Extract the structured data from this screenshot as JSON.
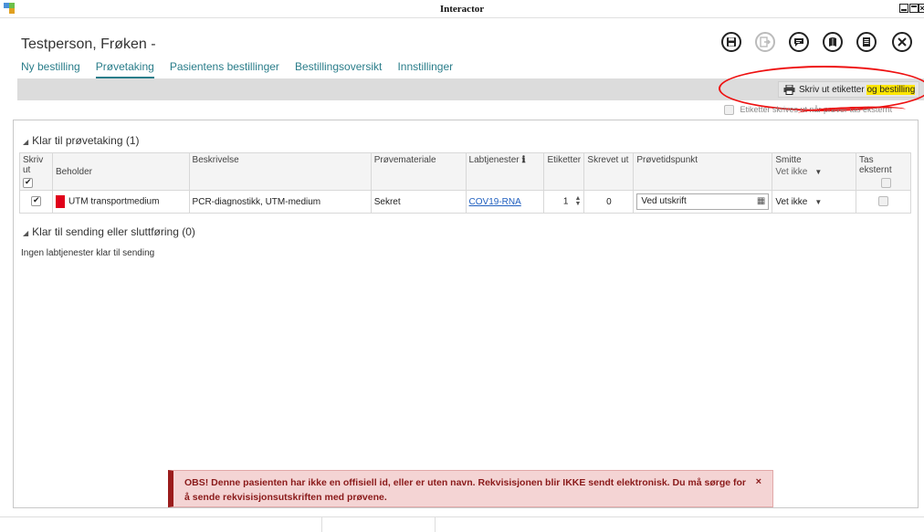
{
  "window": {
    "title": "Interactor"
  },
  "patient": {
    "name": "Testperson, Frøken -"
  },
  "nav": {
    "tabs": [
      {
        "label": "Ny bestilling"
      },
      {
        "label": "Prøvetaking"
      },
      {
        "label": "Pasientens bestillinger"
      },
      {
        "label": "Bestillingsoversikt"
      },
      {
        "label": "Innstillinger"
      }
    ],
    "active_tab": "Prøvetaking"
  },
  "toolbar": {
    "icons": [
      "save-icon",
      "export-icon",
      "comment-icon",
      "book-icon",
      "document-icon",
      "close-icon"
    ]
  },
  "print_button": {
    "label_part1": "Skriv ut etiketter ",
    "label_part2": "og bestilling"
  },
  "external_option": {
    "label": "Etiketter skrives ut når prøver tas eksternt"
  },
  "section_ready": {
    "title": "Klar til prøvetaking (1)"
  },
  "table": {
    "headers": {
      "print": "Skriv ut",
      "container": "Beholder",
      "description": "Beskrivelse",
      "material": "Prøvemateriale",
      "labservices": "Labtjenester",
      "labels": "Etiketter",
      "printed": "Skrevet ut",
      "time": "Prøvetidspunkt",
      "infection": "Smitte",
      "infection_sub": "Vet ikke",
      "external": "Tas eksternt"
    },
    "rows": [
      {
        "container": "UTM transportmedium",
        "description": "PCR-diagnostikk, UTM-medium",
        "material": "Sekret",
        "labservice": "COV19-RNA",
        "labels": "1",
        "printed": "0",
        "time": "Ved utskrift",
        "infection": "Vet ikke"
      }
    ]
  },
  "section_send": {
    "title": "Klar til sending eller sluttføring (0)",
    "empty": "Ingen labtjenester klar til sending"
  },
  "warning": {
    "message": "OBS! Denne pasienten har ikke en offisiell id, eller er uten navn. Rekvisisjonen blir IKKE sendt elektronisk. Du må sørge for å sende rekvisisjonsutskriften med prøvene.",
    "close": "×"
  },
  "colors": {
    "accent": "#2a7d8a",
    "warning_bg": "#f4d4d4",
    "warning_border": "#9b1c1c",
    "highlight": "#ffe600",
    "annotation_red": "#e11111"
  }
}
